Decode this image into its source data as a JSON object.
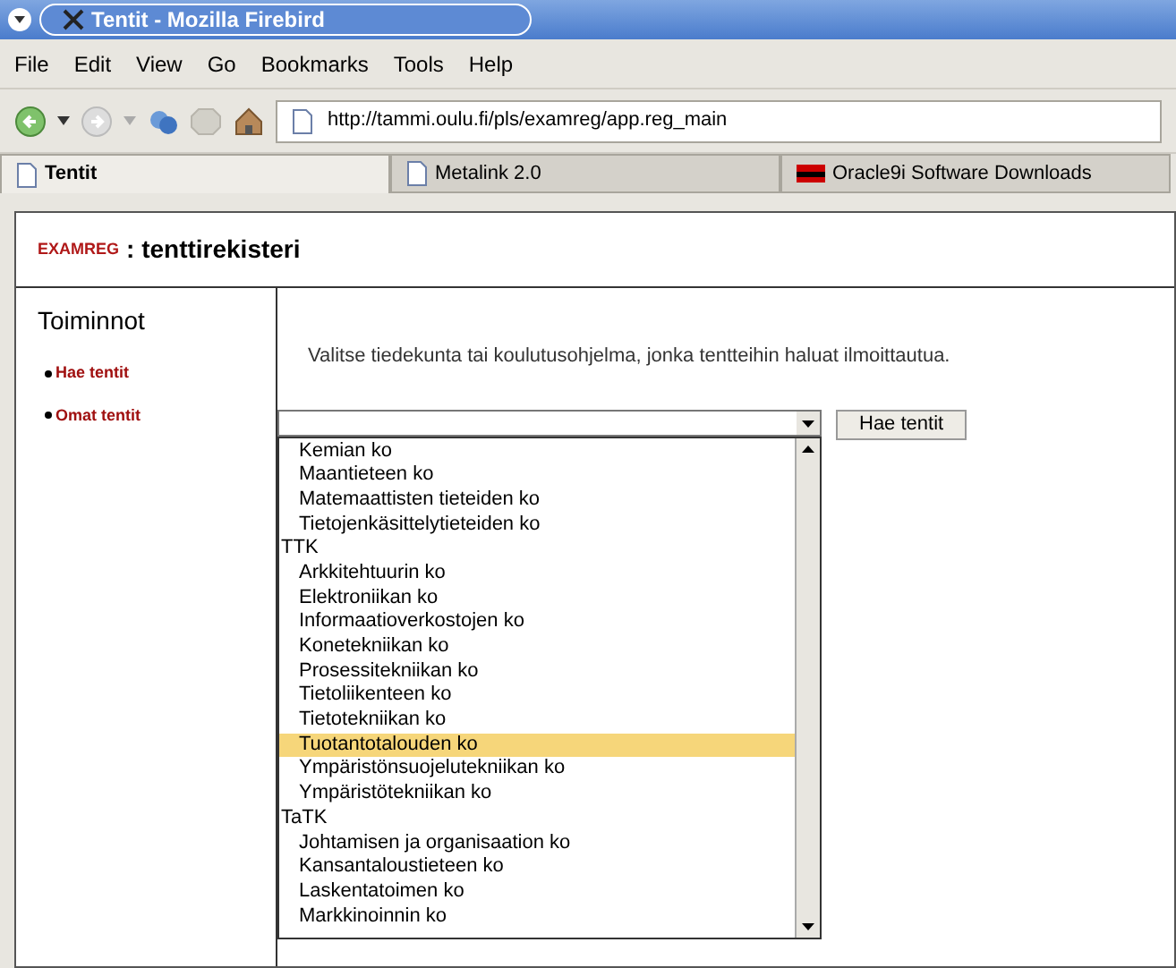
{
  "window": {
    "title": "Tentit - Mozilla Firebird"
  },
  "menu": [
    "File",
    "Edit",
    "View",
    "Go",
    "Bookmarks",
    "Tools",
    "Help"
  ],
  "address": "http://tammi.oulu.fi/pls/examreg/app.reg_main",
  "tabs": [
    {
      "label": "Tentit",
      "selected": true,
      "kind": "page"
    },
    {
      "label": "Metalink 2.0",
      "selected": false,
      "kind": "page"
    },
    {
      "label": "Oracle9i Software Downloads",
      "selected": false,
      "kind": "otn"
    }
  ],
  "header": {
    "brand": "EXAMREG",
    "title": ": tenttirekisteri"
  },
  "sidebar": {
    "title": "Toiminnot",
    "items": [
      "Hae tentit",
      "Omat tentit"
    ]
  },
  "instruction": "Valitse tiedekunta tai koulutusohjelma, jonka tentteihin haluat ilmoittautua.",
  "button": "Hae tentit",
  "options": [
    {
      "label": "Kemian ko",
      "kind": "option",
      "selected": false
    },
    {
      "label": "Maantieteen ko",
      "kind": "option",
      "selected": false
    },
    {
      "label": "Matemaattisten tieteiden ko",
      "kind": "option",
      "selected": false
    },
    {
      "label": "Tietojenkäsittelytieteiden ko",
      "kind": "option",
      "selected": false
    },
    {
      "label": "TTK",
      "kind": "group",
      "selected": false
    },
    {
      "label": "Arkkitehtuurin ko",
      "kind": "option",
      "selected": false
    },
    {
      "label": "Elektroniikan ko",
      "kind": "option",
      "selected": false
    },
    {
      "label": "Informaatioverkostojen ko",
      "kind": "option",
      "selected": false
    },
    {
      "label": "Konetekniikan ko",
      "kind": "option",
      "selected": false
    },
    {
      "label": "Prosessitekniikan ko",
      "kind": "option",
      "selected": false
    },
    {
      "label": "Tietoliikenteen ko",
      "kind": "option",
      "selected": false
    },
    {
      "label": "Tietotekniikan ko",
      "kind": "option",
      "selected": false
    },
    {
      "label": "Tuotantotalouden ko",
      "kind": "option",
      "selected": true
    },
    {
      "label": "Ympäristönsuojelutekniikan ko",
      "kind": "option",
      "selected": false
    },
    {
      "label": "Ympäristötekniikan ko",
      "kind": "option",
      "selected": false
    },
    {
      "label": "TaTK",
      "kind": "group",
      "selected": false
    },
    {
      "label": "Johtamisen ja organisaation ko",
      "kind": "option",
      "selected": false
    },
    {
      "label": "Kansantaloustieteen ko",
      "kind": "option",
      "selected": false
    },
    {
      "label": "Laskentatoimen ko",
      "kind": "option",
      "selected": false
    },
    {
      "label": "Markkinoinnin ko",
      "kind": "option",
      "selected": false
    }
  ]
}
